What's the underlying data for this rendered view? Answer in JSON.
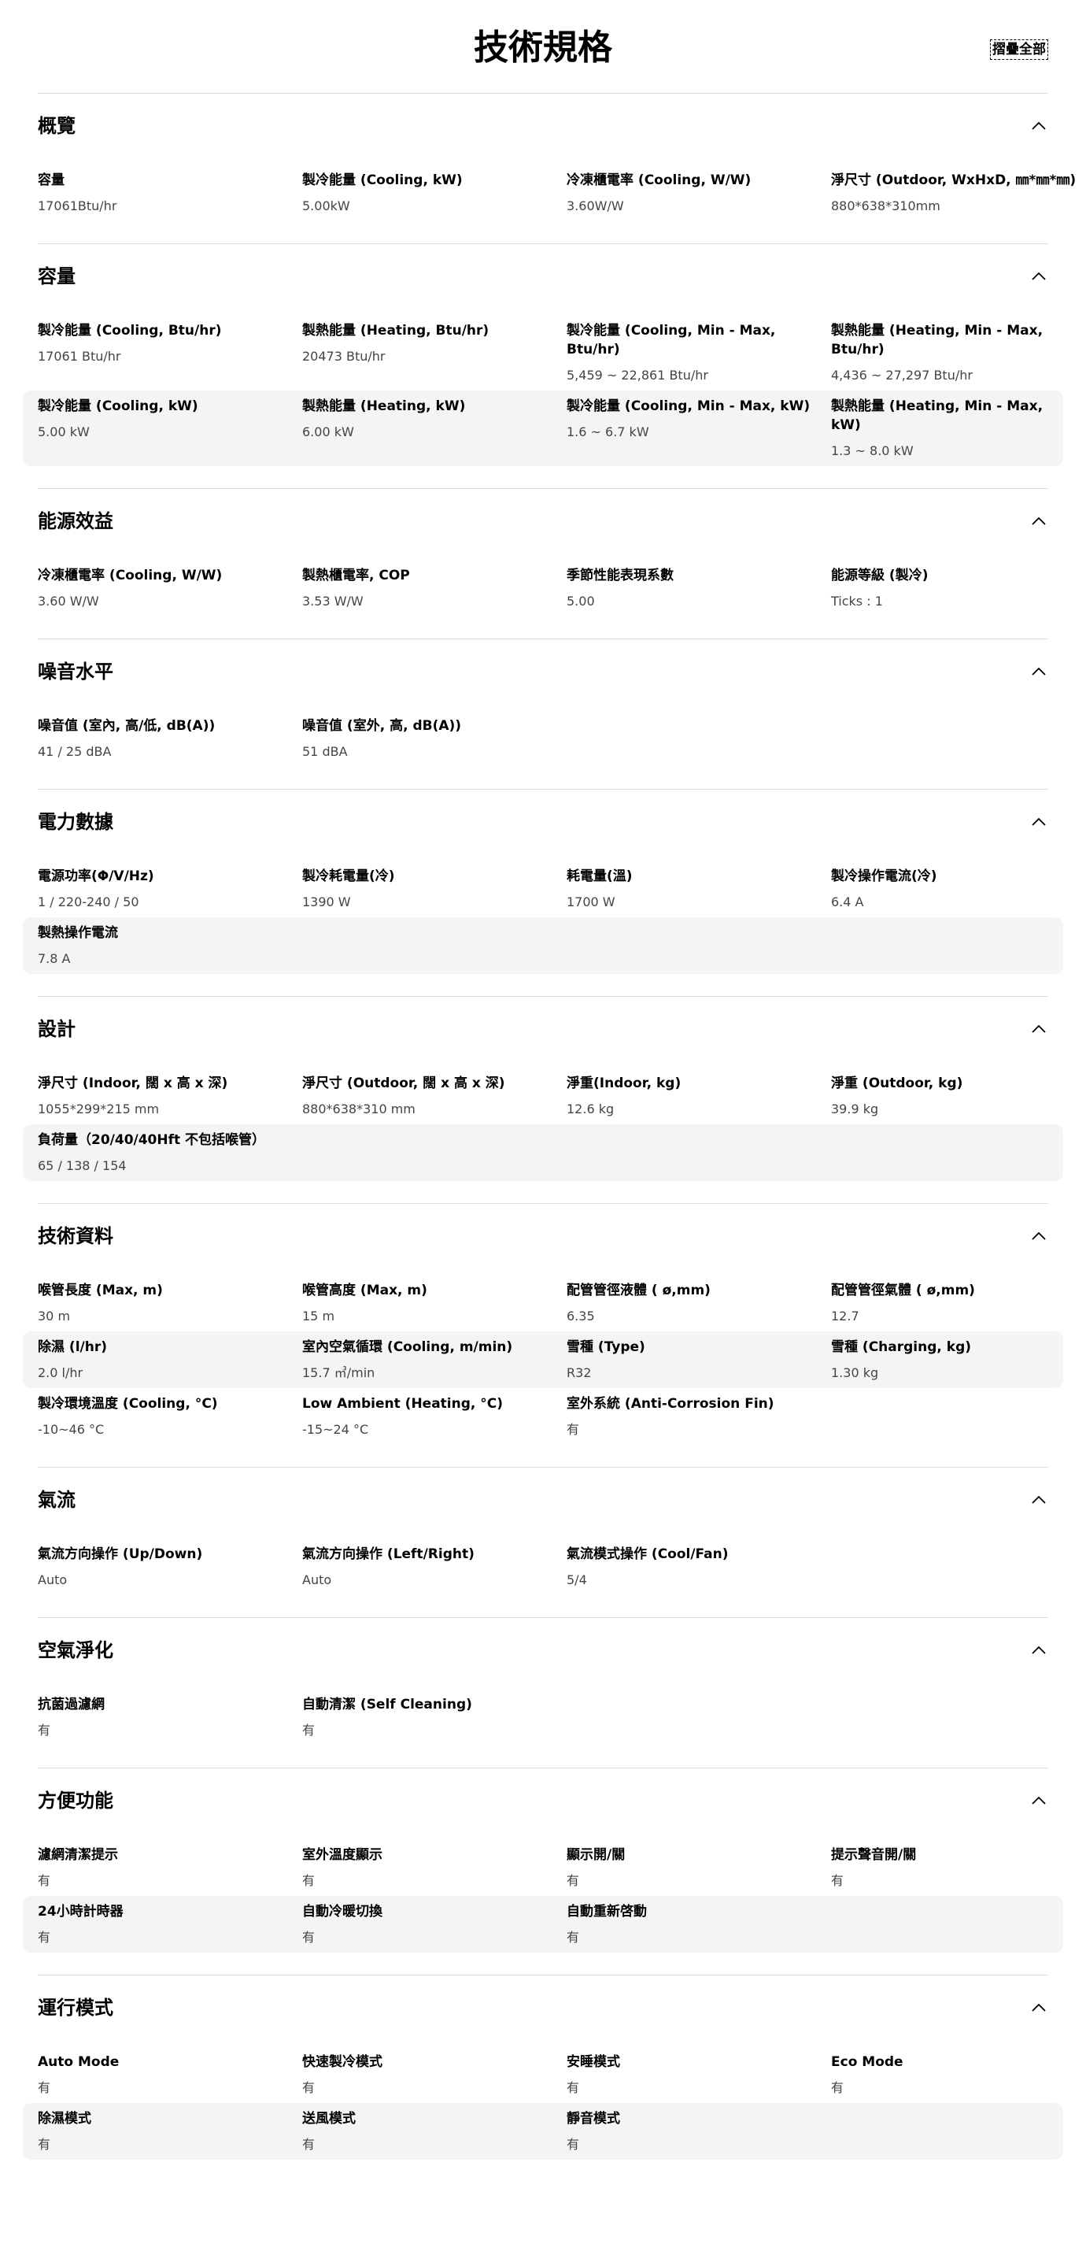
{
  "header": {
    "title": "技術規格",
    "collapse_all": "摺疊全部"
  },
  "sections": [
    {
      "title": "概覽",
      "rows": [
        [
          {
            "label": "容量",
            "value": "17061Btu/hr"
          },
          {
            "label": "製冷能量 (Cooling, kW)",
            "value": "5.00kW"
          },
          {
            "label": "冷凍櫃電率 (Cooling, W/W)",
            "value": "3.60W/W"
          },
          {
            "label": "淨尺寸 (Outdoor, WxHxD, ㎜*㎜*㎜)",
            "value": "880*638*310mm"
          }
        ]
      ]
    },
    {
      "title": "容量",
      "rows": [
        [
          {
            "label": "製冷能量 (Cooling, Btu/hr)",
            "value": "17061 Btu/hr"
          },
          {
            "label": "製熱能量 (Heating, Btu/hr)",
            "value": "20473 Btu/hr"
          },
          {
            "label": "製冷能量 (Cooling, Min - Max, Btu/hr)",
            "value": "5,459 ~ 22,861 Btu/hr"
          },
          {
            "label": "製熱能量 (Heating, Min - Max, Btu/hr)",
            "value": "4,436 ~ 27,297 Btu/hr"
          }
        ],
        [
          {
            "label": "製冷能量 (Cooling, kW)",
            "value": "5.00 kW"
          },
          {
            "label": "製熱能量 (Heating, kW)",
            "value": "6.00 kW"
          },
          {
            "label": "製冷能量 (Cooling, Min - Max, kW)",
            "value": "1.6 ~ 6.7 kW"
          },
          {
            "label": "製熱能量 (Heating, Min - Max, kW)",
            "value": "1.3 ~ 8.0 kW"
          }
        ]
      ]
    },
    {
      "title": "能源效益",
      "rows": [
        [
          {
            "label": "冷凍櫃電率 (Cooling, W/W)",
            "value": "3.60 W/W"
          },
          {
            "label": "製熱櫃電率, COP",
            "value": "3.53 W/W"
          },
          {
            "label": "季節性能表現系數",
            "value": "5.00"
          },
          {
            "label": "能源等級 (製冷)",
            "value": "Ticks : 1"
          }
        ]
      ]
    },
    {
      "title": "噪音水平",
      "rows": [
        [
          {
            "label": "噪音值 (室內, 高/低, dB(A))",
            "value": "41 / 25 dBA"
          },
          {
            "label": "噪音值 (室外, 高, dB(A))",
            "value": "51 dBA"
          }
        ]
      ]
    },
    {
      "title": "電力數據",
      "rows": [
        [
          {
            "label": "電源功率(Φ/V/Hz)",
            "value": "1 / 220-240 / 50"
          },
          {
            "label": "製冷耗電量(冷)",
            "value": "1390 W"
          },
          {
            "label": "耗電量(溫)",
            "value": "1700 W"
          },
          {
            "label": "製冷操作電流(冷)",
            "value": "6.4 A"
          }
        ],
        [
          {
            "label": "製熱操作電流",
            "value": "7.8 A"
          }
        ]
      ]
    },
    {
      "title": "設計",
      "rows": [
        [
          {
            "label": "淨尺寸 (Indoor, 闊 x 高 x 深)",
            "value": "1055*299*215 mm"
          },
          {
            "label": "淨尺寸 (Outdoor, 闊 x 高 x 深)",
            "value": "880*638*310 mm"
          },
          {
            "label": "淨重(Indoor, kg)",
            "value": "12.6 kg"
          },
          {
            "label": "淨重 (Outdoor, kg)",
            "value": "39.9 kg"
          }
        ],
        [
          {
            "label": "負荷量（20/40/40Hft 不包括喉管）",
            "value": "65 / 138 / 154"
          }
        ]
      ]
    },
    {
      "title": "技術資料",
      "rows": [
        [
          {
            "label": "喉管長度 (Max, m)",
            "value": "30 m"
          },
          {
            "label": "喉管高度 (Max, m)",
            "value": "15 m"
          },
          {
            "label": "配管管徑液體 ( ø,mm)",
            "value": "6.35"
          },
          {
            "label": "配管管徑氣體 ( ø,mm)",
            "value": "12.7"
          }
        ],
        [
          {
            "label": "除濕 (l/hr)",
            "value": "2.0 l/hr"
          },
          {
            "label": "室內空氣循環 (Cooling, m/min)",
            "value": "15.7 ㎥/min"
          },
          {
            "label": "雪種 (Type)",
            "value": "R32"
          },
          {
            "label": "雪種 (Charging, kg)",
            "value": "1.30 kg"
          }
        ],
        [
          {
            "label": "製冷環境溫度 (Cooling, °C)",
            "value": "-10~46 °C"
          },
          {
            "label": "Low Ambient (Heating, °C)",
            "value": "-15~24 °C"
          },
          {
            "label": "室外系統 (Anti-Corrosion Fin)",
            "value": "有"
          }
        ]
      ]
    },
    {
      "title": "氣流",
      "rows": [
        [
          {
            "label": "氣流方向操作 (Up/Down)",
            "value": "Auto"
          },
          {
            "label": "氣流方向操作 (Left/Right)",
            "value": "Auto"
          },
          {
            "label": "氣流模式操作 (Cool/Fan)",
            "value": "5/4"
          }
        ]
      ]
    },
    {
      "title": "空氣淨化",
      "rows": [
        [
          {
            "label": "抗菌過濾網",
            "value": "有"
          },
          {
            "label": "自動清潔 (Self Cleaning)",
            "value": "有"
          }
        ]
      ]
    },
    {
      "title": "方便功能",
      "rows": [
        [
          {
            "label": "濾網清潔提示",
            "value": "有"
          },
          {
            "label": "室外溫度顯示",
            "value": "有"
          },
          {
            "label": "顯示開/關",
            "value": "有"
          },
          {
            "label": "提示聲音開/關",
            "value": "有"
          }
        ],
        [
          {
            "label": "24小時計時器",
            "value": "有"
          },
          {
            "label": "自動冷暖切換",
            "value": "有"
          },
          {
            "label": "自動重新啓動",
            "value": "有"
          }
        ]
      ]
    },
    {
      "title": "運行模式",
      "rows": [
        [
          {
            "label": "Auto Mode",
            "value": "有"
          },
          {
            "label": "快速製冷模式",
            "value": "有"
          },
          {
            "label": "安睡模式",
            "value": "有"
          },
          {
            "label": "Eco Mode",
            "value": "有"
          }
        ],
        [
          {
            "label": "除濕模式",
            "value": "有"
          },
          {
            "label": "送風模式",
            "value": "有"
          },
          {
            "label": "靜音模式",
            "value": "有"
          }
        ]
      ]
    }
  ]
}
